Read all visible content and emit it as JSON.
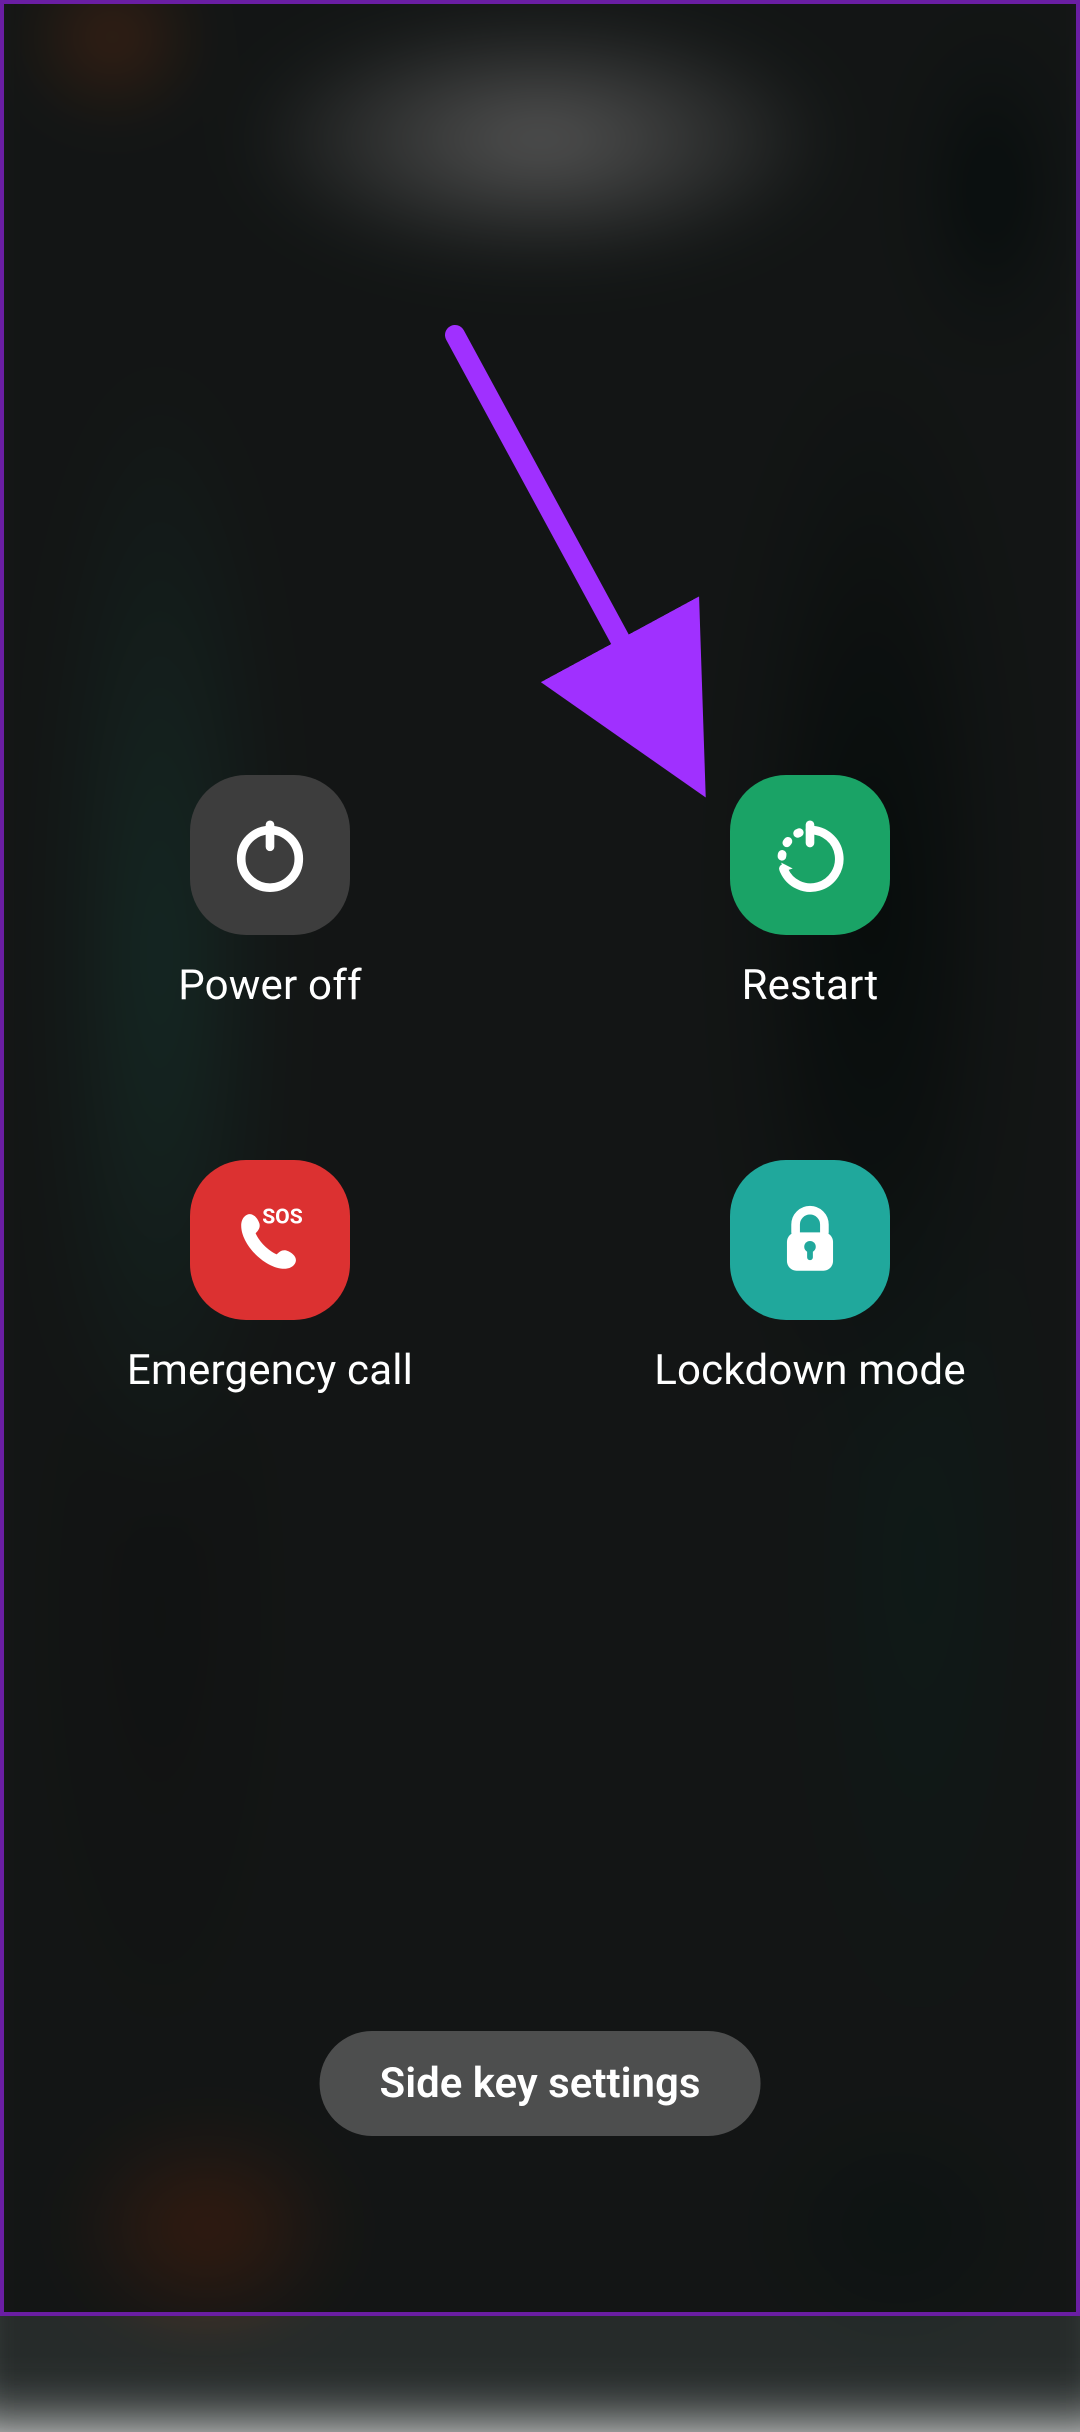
{
  "options": {
    "power_off": {
      "label": "Power off"
    },
    "restart": {
      "label": "Restart"
    },
    "emergency_call": {
      "label": "Emergency call",
      "badge": "SOS"
    },
    "lockdown": {
      "label": "Lockdown mode"
    }
  },
  "footer": {
    "side_key_settings": "Side key settings"
  },
  "colors": {
    "power_off": "#3d3d3d",
    "restart": "#1aa366",
    "emergency": "#dc3131",
    "lockdown": "#20a89c",
    "annotation_arrow": "#a030ff",
    "frame": "#6a1ea3"
  }
}
